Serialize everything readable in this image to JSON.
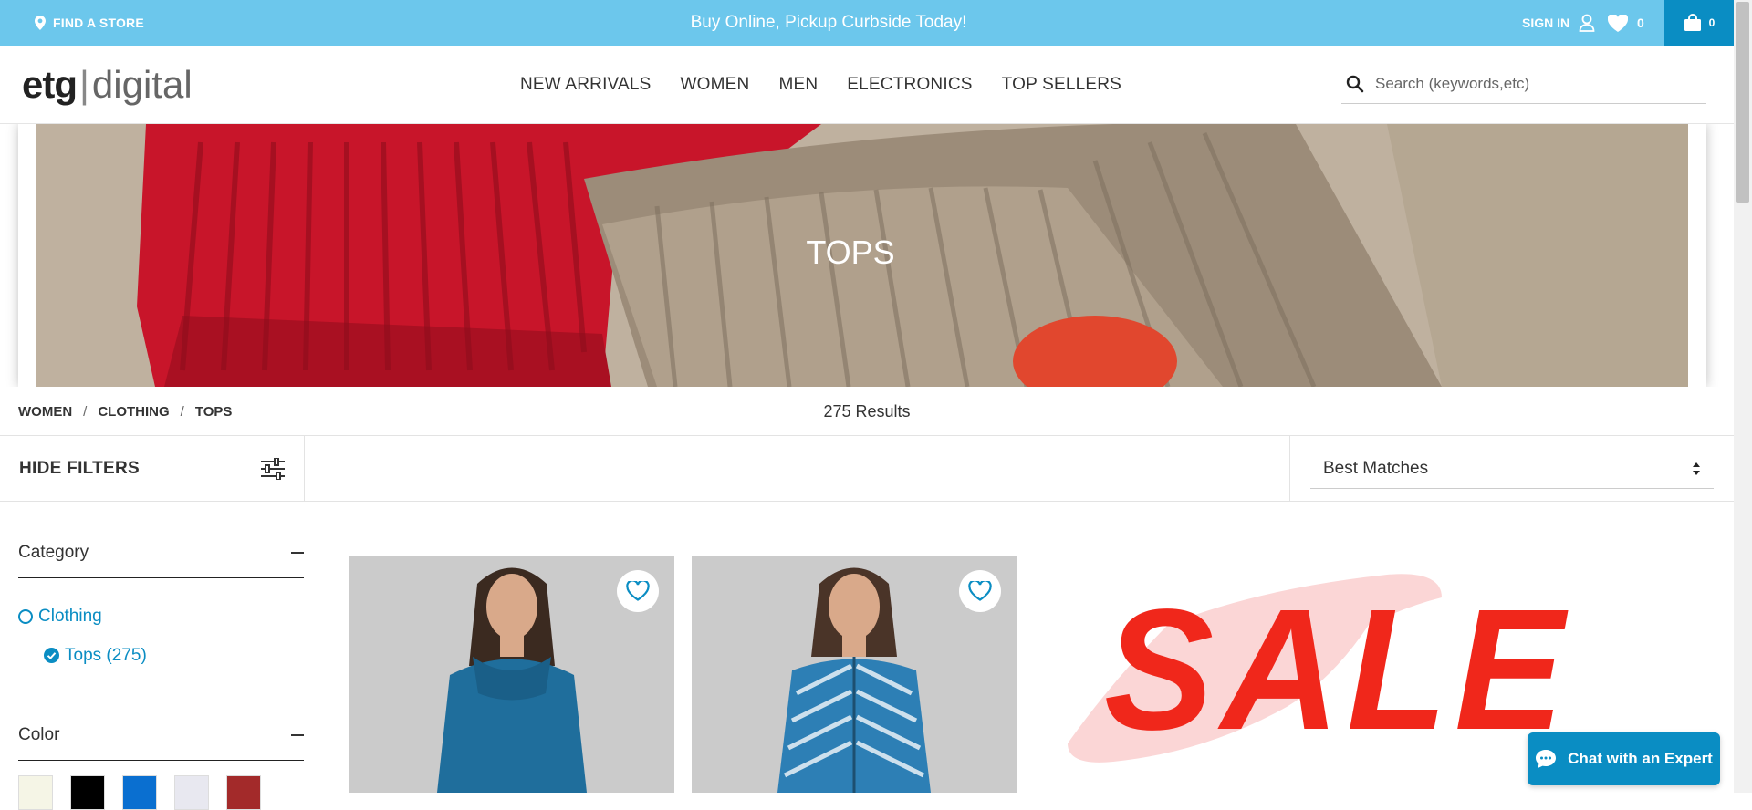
{
  "topbar": {
    "find_store": "FIND A STORE",
    "promo": "Buy Online, Pickup Curbside Today!",
    "sign_in": "SIGN IN",
    "wishlist_count": "0",
    "bag_count": "0"
  },
  "header": {
    "logo_part1": "etg",
    "logo_part2": "digital",
    "nav": [
      "NEW ARRIVALS",
      "WOMEN",
      "MEN",
      "ELECTRONICS",
      "TOP SELLERS"
    ],
    "search_placeholder": "Search (keywords,etc)"
  },
  "hero": {
    "title": "TOPS"
  },
  "breadcrumb": [
    "WOMEN",
    "CLOTHING",
    "TOPS"
  ],
  "results": "275 Results",
  "filters": {
    "hide_label": "HIDE FILTERS",
    "sort_value": "Best Matches"
  },
  "sidebar": {
    "category_title": "Category",
    "category_items": [
      {
        "label": "Clothing",
        "selected": false
      },
      {
        "label": "Tops (275)",
        "selected": true
      }
    ],
    "color_title": "Color",
    "colors": [
      "#f5f5e6",
      "#000000",
      "#0a6fd0",
      "#e8e8f0",
      "#a32a2a"
    ]
  },
  "promo_tile": {
    "text": "SALE"
  },
  "chat": {
    "label": "Chat with an Expert"
  },
  "colors": {
    "accent": "#0a8dc3",
    "topbar": "#6cc7ec",
    "sale_red": "#f0271b"
  }
}
